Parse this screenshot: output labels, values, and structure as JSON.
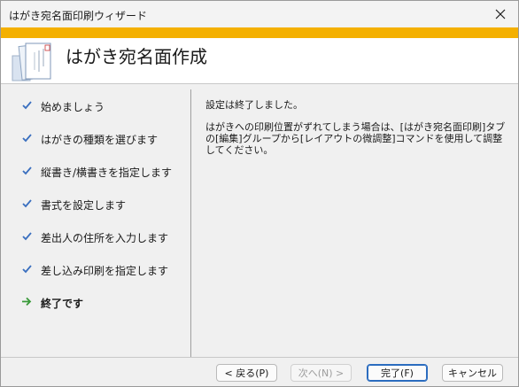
{
  "window": {
    "title": "はがき宛名面印刷ウィザード",
    "close_icon": "close-icon",
    "accent_color": "#f4b000"
  },
  "header": {
    "heading": "はがき宛名面作成",
    "icon": "postcard-wizard-icon"
  },
  "steps": [
    {
      "label": "始めましょう",
      "state": "done"
    },
    {
      "label": "はがきの種類を選びます",
      "state": "done"
    },
    {
      "label": "縦書き/横書きを指定します",
      "state": "done"
    },
    {
      "label": "書式を設定します",
      "state": "done"
    },
    {
      "label": "差出人の住所を入力します",
      "state": "done"
    },
    {
      "label": "差し込み印刷を指定します",
      "state": "done"
    },
    {
      "label": "終了です",
      "state": "current"
    }
  ],
  "content": {
    "line1": "設定は終了しました。",
    "line2": "はがきへの印刷位置がずれてしまう場合は、[はがき宛名面印刷]タブの[編集]グループから[レイアウトの微調整]コマンドを使用して調整してください。"
  },
  "footer": {
    "back_label": "< 戻る(P)",
    "next_label": "次へ(N) >",
    "finish_label": "完了(F)",
    "cancel_label": "キャンセル"
  }
}
